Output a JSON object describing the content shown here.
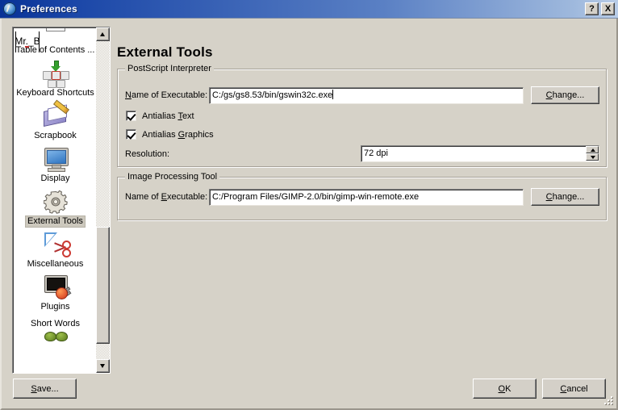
{
  "window": {
    "title": "Preferences",
    "icon": "globe-icon",
    "help_button": "?",
    "close_button": "X"
  },
  "sidebar": {
    "items": [
      {
        "label": "Table of Contents ...",
        "icon": "document-toc-icon",
        "selected": false,
        "partial_top": true
      },
      {
        "label": "Keyboard Shortcuts",
        "icon": "keyboard-keys-icon",
        "selected": false
      },
      {
        "label": "Scrapbook",
        "icon": "book-pencil-icon",
        "selected": false
      },
      {
        "label": "Display",
        "icon": "monitor-icon",
        "selected": false
      },
      {
        "label": "External Tools",
        "icon": "gear-icon",
        "selected": true
      },
      {
        "label": "Miscellaneous",
        "icon": "triangle-scissors-icon",
        "selected": false
      },
      {
        "label": "Plugins",
        "icon": "monitor-plug-icon",
        "selected": false
      },
      {
        "label": "Mr._B",
        "icon": "mr-b-text-icon",
        "selected": false
      },
      {
        "label": "Short Words",
        "icon": "short-words-icon",
        "selected": false
      }
    ],
    "scroll_up": "▲",
    "scroll_down": "▼"
  },
  "main": {
    "title": "External Tools",
    "postscript": {
      "group_title": "PostScript Interpreter",
      "executable_label": "Name of Executable:",
      "executable_value": "C:/gs/gs8.53/bin/gswin32c.exe",
      "change_button": "Change...",
      "antialias_text_label": "Antialias Text",
      "antialias_text_checked": true,
      "antialias_graphics_label": "Antialias Graphics",
      "antialias_graphics_checked": true,
      "resolution_label": "Resolution:",
      "resolution_value": "72 dpi"
    },
    "image_tool": {
      "group_title": "Image Processing Tool",
      "executable_label": "Name of Executable:",
      "executable_value": "C:/Program Files/GIMP-2.0/bin/gimp-win-remote.exe",
      "change_button": "Change..."
    }
  },
  "footer": {
    "save_button": "Save...",
    "ok_button": "OK",
    "cancel_button": "Cancel"
  },
  "colors": {
    "dialog_background": "#d6d2c8",
    "titlebar_start": "#083296",
    "titlebar_end": "#b9cde8",
    "selection_highlight": "#ccc8bd",
    "field_background": "#ffffff"
  }
}
